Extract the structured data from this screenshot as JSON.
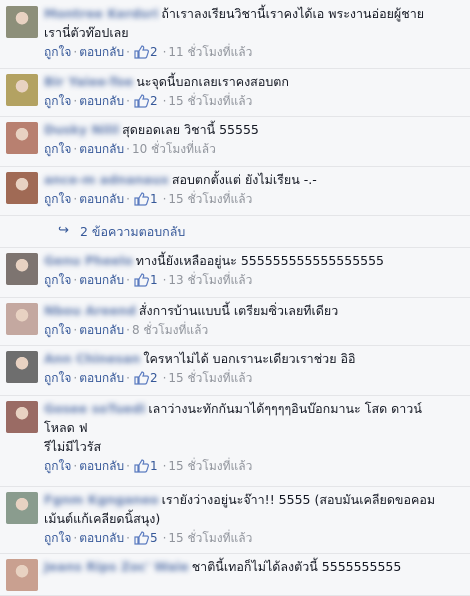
{
  "actions": {
    "like": "ถูกใจ",
    "reply": "ตอบกลับ",
    "separator": "·"
  },
  "replies_link": "2 ข้อความตอบกลับ",
  "comments": [
    {
      "author": "Montree Kerdsri",
      "text": "ถ้าเราลงเรียนวิชานี้เราคงได้เอ พระงานอ่อยผู้ชาย\nเรานี่ตัวท๊อปเลย",
      "likes": "2",
      "time": "11 ชั่วโมงที่แล้ว",
      "avatar_color": "#8d8f7a"
    },
    {
      "author": "Bir Yaiee-Toe",
      "text": "นะจุดนี้บอกเลยเราคงสอบตก",
      "likes": "2",
      "time": "15 ชั่วโมงที่แล้ว",
      "avatar_color": "#b3a262"
    },
    {
      "author": "Dusky Nilil",
      "text": "สุดยอดเลย วิชานี้ 55555",
      "likes": "",
      "time": "10 ชั่วโมงที่แล้ว",
      "avatar_color": "#b88070"
    },
    {
      "author": "ance-m adnanaux",
      "text": "สอบตกตั้งแต่ ยังไม่เรียน -.-",
      "likes": "1",
      "time": "15 ชั่วโมงที่แล้ว",
      "avatar_color": "#a06a55"
    },
    {
      "author": "Genu Pheelo",
      "text": "ทางนี้ยังเหลืออยู่นะ 555555555555555555",
      "likes": "1",
      "time": "13 ชั่วโมงที่แล้ว",
      "avatar_color": "#7d7470"
    },
    {
      "author": "Nbou Areend",
      "text": "สั่งการบ้านแบบนี้ เตรียมซิ่วเลยทีเดียว",
      "likes": "",
      "time": "8 ชั่วโมงที่แล้ว",
      "avatar_color": "#c4a8a0"
    },
    {
      "author": "Ann Chinesan",
      "text": "ใครหาไม่ได้ บอกเรานะเดียวเราช่วย อิอิ",
      "likes": "2",
      "time": "15 ชั่วโมงที่แล้ว",
      "avatar_color": "#6e6e6e"
    },
    {
      "author": "Gosee soTuedi",
      "text": "เลาว่างนะทักกันมาได้ๆๆๆๆอินบ๊อกมานะ โสด ดาวน์\nโหลด ฟ\nรีไม่มีไวรัส",
      "likes": "1",
      "time": "15 ชั่วโมงที่แล้ว",
      "avatar_color": "#9a6b64"
    },
    {
      "author": "Fgnm Kgnganeo",
      "text": "เรายังว่างอยู่นะจ๊าา!! 5555 (สอบมันเคลียดขอคอม\nเม้นต์แก้เคลียดนิ้สนุง)",
      "likes": "5",
      "time": "15 ชั่วโมงที่แล้ว",
      "avatar_color": "#8a9c8e"
    },
    {
      "author": "Jeans Rips Zoc' Waie",
      "text": "ชาตินี้เทอก็ไม่ได้ลงตัวนี้ 5555555555",
      "likes": "",
      "time": "",
      "avatar_color": "#c9a090"
    }
  ]
}
